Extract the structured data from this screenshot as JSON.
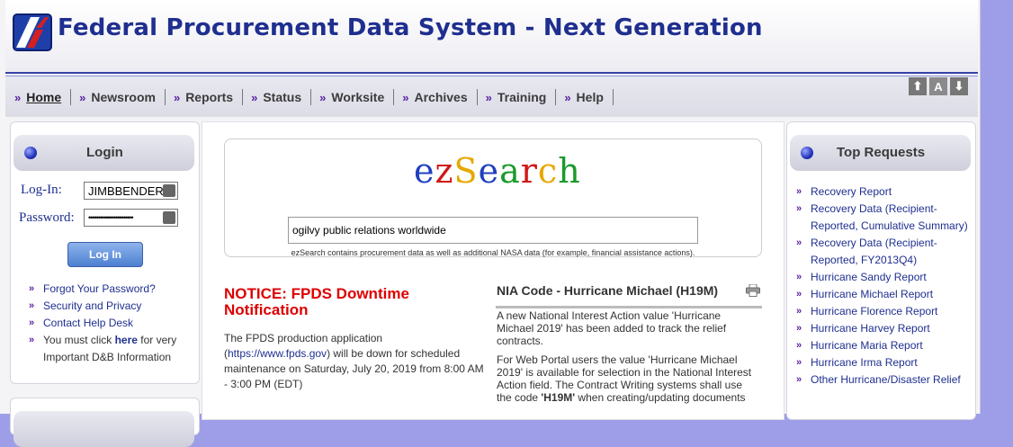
{
  "header": {
    "title": "Federal Procurement Data System - Next Generation"
  },
  "nav": {
    "marker": "»",
    "items": [
      "Home",
      "Newsroom",
      "Reports",
      "Status",
      "Worksite",
      "Archives",
      "Training",
      "Help"
    ]
  },
  "font_controls": {
    "up": "⬆",
    "mid": "A",
    "down": "⬇"
  },
  "login": {
    "title": "Login",
    "login_label": "Log-In:",
    "login_value": "JIMBBENDER@",
    "password_label": "Password:",
    "password_value": "•••••••••••••••••••••••",
    "button_label": "Log In",
    "links": {
      "forgot": "Forgot Your Password?",
      "security": "Security and Privacy",
      "helpdesk": "Contact Help Desk",
      "must_click_pre": "You must click ",
      "must_click_link": "here",
      "must_click_post": " for very Important D&B Information"
    }
  },
  "ezsearch": {
    "logo_letters": [
      {
        "ch": "e",
        "color": "#1f3fbf"
      },
      {
        "ch": "z",
        "color": "#d01818"
      },
      {
        "ch": "S",
        "color": "#e6a800"
      },
      {
        "ch": "e",
        "color": "#1f3fbf"
      },
      {
        "ch": "a",
        "color": "#1a9a2a"
      },
      {
        "ch": "r",
        "color": "#d01818"
      },
      {
        "ch": "c",
        "color": "#e6a800"
      },
      {
        "ch": "h",
        "color": "#1a9a2a"
      }
    ],
    "query": "ogilvy public relations worldwide",
    "note": "ezSearch contains procurement data as well as additional NASA data (for example, financial assistance actions)."
  },
  "notice": {
    "title": "NOTICE: FPDS Downtime Notification",
    "body_pre": "The FPDS production application (",
    "body_link": "https://www.fpds.gov",
    "body_post": ") will be down for scheduled maintenance on Saturday, July 20, 2019 from 8:00 AM - 3:00 PM (EDT)"
  },
  "nia": {
    "title": "NIA Code - Hurricane Michael (H19M)",
    "p1": "A new National Interest Action value 'Hurricane Michael 2019' has been added to track the relief contracts.",
    "p2_pre": "For Web Portal users the value 'Hurricane Michael 2019' is available for selection in the National Interest Action field. The Contract Writing systems shall use the code ",
    "p2_code": "'H19M'",
    "p2_post": " when creating/updating documents"
  },
  "top_requests": {
    "title": "Top Requests",
    "items": [
      "Recovery Report",
      "Recovery Data (Recipient-Reported, Cumulative Summary)",
      "Recovery Data (Recipient-Reported, FY2013Q4)",
      "Hurricane Sandy Report",
      "Hurricane Michael Report",
      "Hurricane Florence Report",
      "Hurricane Harvey Report",
      "Hurricane Maria Report",
      "Hurricane Irma Report",
      "Other Hurricane/Disaster Relief"
    ]
  }
}
